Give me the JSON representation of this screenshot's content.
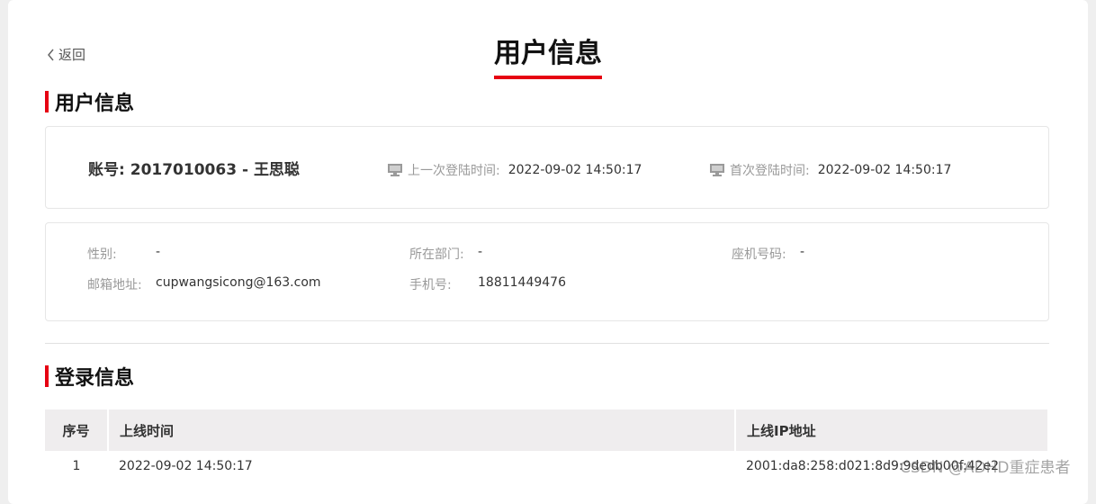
{
  "header": {
    "back_label": "返回",
    "title": "用户信息"
  },
  "user_section": {
    "title": "用户信息",
    "account_label": "账号:",
    "account_id": "2017010063",
    "account_sep": "-",
    "account_name": "王思聪",
    "last_login_label": "上一次登陆时间:",
    "last_login_value": "2022-09-02 14:50:17",
    "first_login_label": "首次登陆时间:",
    "first_login_value": "2022-09-02 14:50:17"
  },
  "details": {
    "gender_label": "性别:",
    "gender_value": "-",
    "department_label": "所在部门:",
    "department_value": "-",
    "landline_label": "座机号码:",
    "landline_value": "-",
    "email_label": "邮箱地址:",
    "email_value": "cupwangsicong@163.com",
    "mobile_label": "手机号:",
    "mobile_value": "18811449476"
  },
  "login_section": {
    "title": "登录信息",
    "columns": [
      "序号",
      "上线时间",
      "上线IP地址"
    ],
    "rows": [
      [
        "1",
        "2022-09-02 14:50:17",
        "2001:da8:258:d021:8d9:9dedb00f:42e2"
      ]
    ]
  },
  "watermark": "CSDN @ADHD重症患者",
  "icons": [
    "chevron-left-icon",
    "monitor-icon"
  ],
  "colors": {
    "accent": "#e60012",
    "table_header_bg": "#efedee"
  }
}
